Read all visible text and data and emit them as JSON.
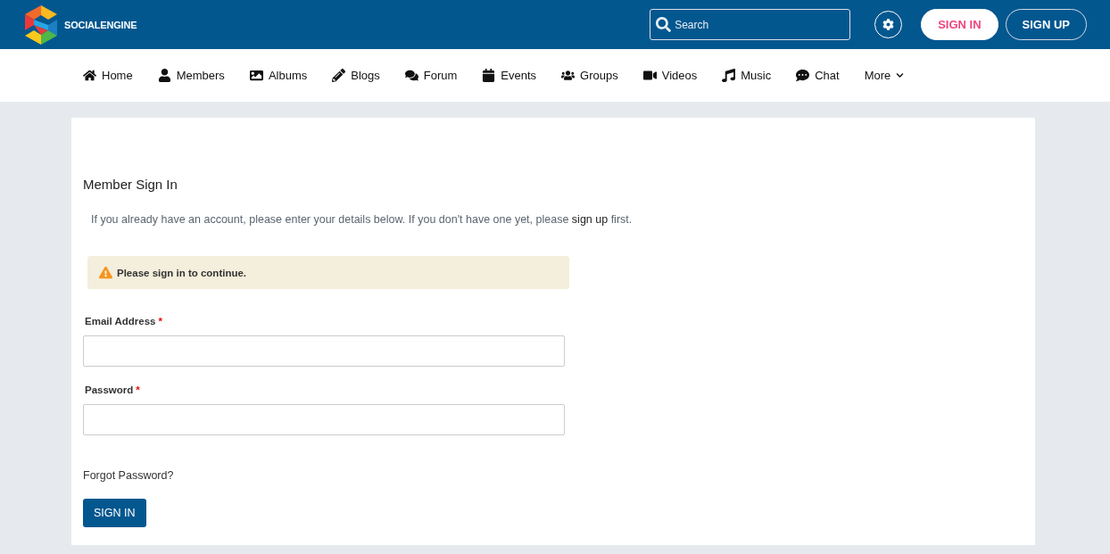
{
  "header": {
    "brand": "SOCIALENGINE",
    "search": {
      "placeholder": "Search"
    },
    "sign_in": "SIGN IN",
    "sign_up": "SIGN UP"
  },
  "nav": [
    {
      "kind": "home",
      "label": "Home"
    },
    {
      "kind": "members",
      "label": "Members"
    },
    {
      "kind": "albums",
      "label": "Albums"
    },
    {
      "kind": "blogs",
      "label": "Blogs"
    },
    {
      "kind": "forum",
      "label": "Forum"
    },
    {
      "kind": "events",
      "label": "Events"
    },
    {
      "kind": "groups",
      "label": "Groups"
    },
    {
      "kind": "videos",
      "label": "Videos"
    },
    {
      "kind": "music",
      "label": "Music"
    },
    {
      "kind": "chat",
      "label": "Chat"
    },
    {
      "kind": "more",
      "label": "More"
    }
  ],
  "form": {
    "title": "Member Sign In",
    "intro": {
      "before": "If you already have an account, please enter your details below. If you don't have one yet, please ",
      "link": "sign up",
      "after": " first."
    },
    "notice": "Please sign in to continue.",
    "fields": [
      {
        "label": "Email Address",
        "required_mark": "*"
      },
      {
        "label": "Password",
        "required_mark": "*"
      }
    ],
    "forgot": "Forgot Password?",
    "submit": "SIGN IN"
  }
}
